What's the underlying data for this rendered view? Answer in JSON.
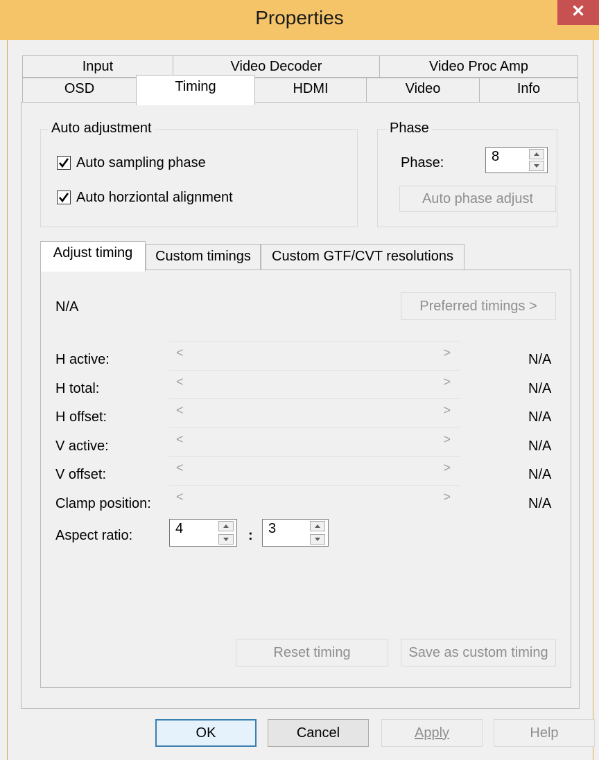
{
  "window": {
    "title": "Properties",
    "close_glyph": "✕"
  },
  "tabs_row1": [
    "Input",
    "Video Decoder",
    "Video Proc Amp"
  ],
  "tabs_row2": [
    "OSD",
    "Timing",
    "HDMI",
    "Video",
    "Info"
  ],
  "auto_adjustment": {
    "legend": "Auto adjustment",
    "auto_sampling_phase": {
      "label": "Auto sampling phase",
      "checked": true
    },
    "auto_horizontal_alignment": {
      "label": "Auto horziontal alignment",
      "checked": true
    }
  },
  "phase": {
    "legend": "Phase",
    "label": "Phase:",
    "value": "8",
    "auto_button": "Auto phase adjust"
  },
  "inner_tabs": [
    "Adjust timing",
    "Custom timings",
    "Custom GTF/CVT resolutions"
  ],
  "adjust_timing": {
    "status": "N/A",
    "preferred_button": "Preferred timings >",
    "rows": [
      {
        "label": "H active:",
        "value": "N/A"
      },
      {
        "label": "H total:",
        "value": "N/A"
      },
      {
        "label": "H offset:",
        "value": "N/A"
      },
      {
        "label": "V active:",
        "value": "N/A"
      },
      {
        "label": "V offset:",
        "value": "N/A"
      },
      {
        "label": "Clamp position:",
        "value": "N/A"
      }
    ],
    "slider_left_glyph": "<",
    "slider_right_glyph": ">",
    "aspect": {
      "label": "Aspect ratio:",
      "w": "4",
      "sep": ":",
      "h": "3"
    },
    "reset_button": "Reset timing",
    "save_button": "Save as custom timing"
  },
  "footer": {
    "ok": "OK",
    "cancel": "Cancel",
    "apply": "Apply",
    "help": "Help"
  },
  "colors": {
    "titlebar": "#f5c468",
    "close": "#c75050",
    "default_border": "#3c7fb1"
  }
}
